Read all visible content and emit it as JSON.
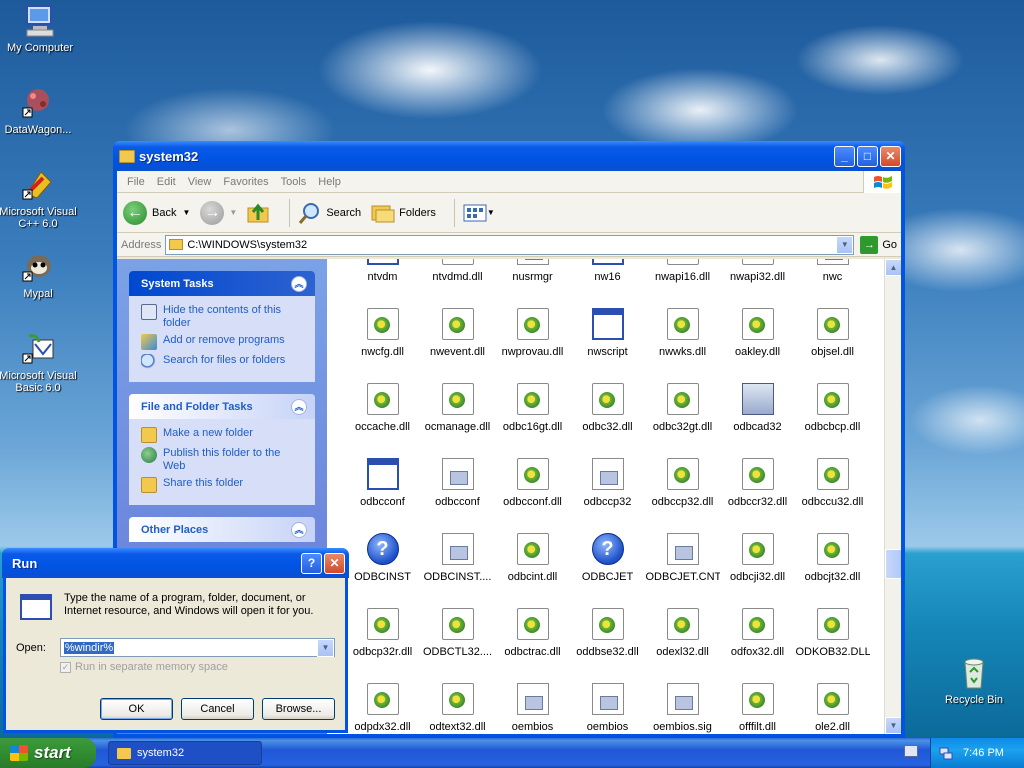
{
  "desktop": {
    "icons": [
      {
        "label": "My Computer"
      },
      {
        "label": "DataWagon..."
      },
      {
        "label": "Microsoft Visual C++ 6.0"
      },
      {
        "label": "Mypal"
      },
      {
        "label": "Microsoft Visual Basic 6.0"
      },
      {
        "label": "Recycle Bin"
      }
    ]
  },
  "explorer": {
    "title": "system32",
    "menu": [
      "File",
      "Edit",
      "View",
      "Favorites",
      "Tools",
      "Help"
    ],
    "toolbar": {
      "back": "Back",
      "search": "Search",
      "folders": "Folders"
    },
    "address": {
      "label": "Address",
      "path": "C:\\WINDOWS\\system32",
      "go": "Go"
    },
    "system_tasks": {
      "header": "System Tasks",
      "items": [
        "Hide the contents of this folder",
        "Add or remove programs",
        "Search for files or folders"
      ]
    },
    "file_tasks": {
      "header": "File and Folder Tasks",
      "items": [
        "Make a new folder",
        "Publish this folder to the Web",
        "Share this folder"
      ]
    },
    "other_places": {
      "header": "Other Places"
    },
    "files": [
      {
        "name": "ntvdm",
        "type": "exe"
      },
      {
        "name": "ntvdmd.dll",
        "type": "dll"
      },
      {
        "name": "nusrmgr",
        "type": "cfg"
      },
      {
        "name": "nw16",
        "type": "exe"
      },
      {
        "name": "nwapi16.dll",
        "type": "dll"
      },
      {
        "name": "nwapi32.dll",
        "type": "dll"
      },
      {
        "name": "nwc",
        "type": "cfg"
      },
      {
        "name": "nwcfg.dll",
        "type": "dll"
      },
      {
        "name": "nwevent.dll",
        "type": "dll"
      },
      {
        "name": "nwprovau.dll",
        "type": "dll"
      },
      {
        "name": "nwscript",
        "type": "exe"
      },
      {
        "name": "nwwks.dll",
        "type": "dll"
      },
      {
        "name": "oakley.dll",
        "type": "dll"
      },
      {
        "name": "objsel.dll",
        "type": "dll"
      },
      {
        "name": "occache.dll",
        "type": "dll"
      },
      {
        "name": "ocmanage.dll",
        "type": "dll"
      },
      {
        "name": "odbc16gt.dll",
        "type": "dll"
      },
      {
        "name": "odbc32.dll",
        "type": "dll"
      },
      {
        "name": "odbc32gt.dll",
        "type": "dll"
      },
      {
        "name": "odbcad32",
        "type": "cpl"
      },
      {
        "name": "odbcbcp.dll",
        "type": "dll"
      },
      {
        "name": "odbcconf",
        "type": "exe"
      },
      {
        "name": "odbcconf",
        "type": "cfg"
      },
      {
        "name": "odbcconf.dll",
        "type": "dll"
      },
      {
        "name": "odbccp32",
        "type": "cfg"
      },
      {
        "name": "odbccp32.dll",
        "type": "dll"
      },
      {
        "name": "odbccr32.dll",
        "type": "dll"
      },
      {
        "name": "odbccu32.dll",
        "type": "dll"
      },
      {
        "name": "ODBCINST",
        "type": "help"
      },
      {
        "name": "ODBCINST....",
        "type": "cfg"
      },
      {
        "name": "odbcint.dll",
        "type": "dll"
      },
      {
        "name": "ODBCJET",
        "type": "help"
      },
      {
        "name": "ODBCJET.CNT",
        "type": "cfg"
      },
      {
        "name": "odbcji32.dll",
        "type": "dll"
      },
      {
        "name": "odbcjt32.dll",
        "type": "dll"
      },
      {
        "name": "odbcp32r.dll",
        "type": "dll"
      },
      {
        "name": "ODBCTL32....",
        "type": "dll"
      },
      {
        "name": "odbctrac.dll",
        "type": "dll"
      },
      {
        "name": "oddbse32.dll",
        "type": "dll"
      },
      {
        "name": "odexl32.dll",
        "type": "dll"
      },
      {
        "name": "odfox32.dll",
        "type": "dll"
      },
      {
        "name": "ODKOB32.DLL",
        "type": "dll"
      },
      {
        "name": "odpdx32.dll",
        "type": "dll"
      },
      {
        "name": "odtext32.dll",
        "type": "dll"
      },
      {
        "name": "oembios",
        "type": "cfg"
      },
      {
        "name": "oembios",
        "type": "cfg"
      },
      {
        "name": "oembios.sig",
        "type": "cfg"
      },
      {
        "name": "offfilt.dll",
        "type": "dll"
      },
      {
        "name": "ole2.dll",
        "type": "dll"
      }
    ]
  },
  "run": {
    "title": "Run",
    "description": "Type the name of a program, folder, document, or Internet resource, and Windows will open it for you.",
    "open_label": "Open:",
    "open_value": "%windir%",
    "checkbox_label": "Run in separate memory space",
    "ok": "OK",
    "cancel": "Cancel",
    "browse": "Browse..."
  },
  "taskbar": {
    "start": "start",
    "task": "system32",
    "clock": "7:46 PM"
  }
}
